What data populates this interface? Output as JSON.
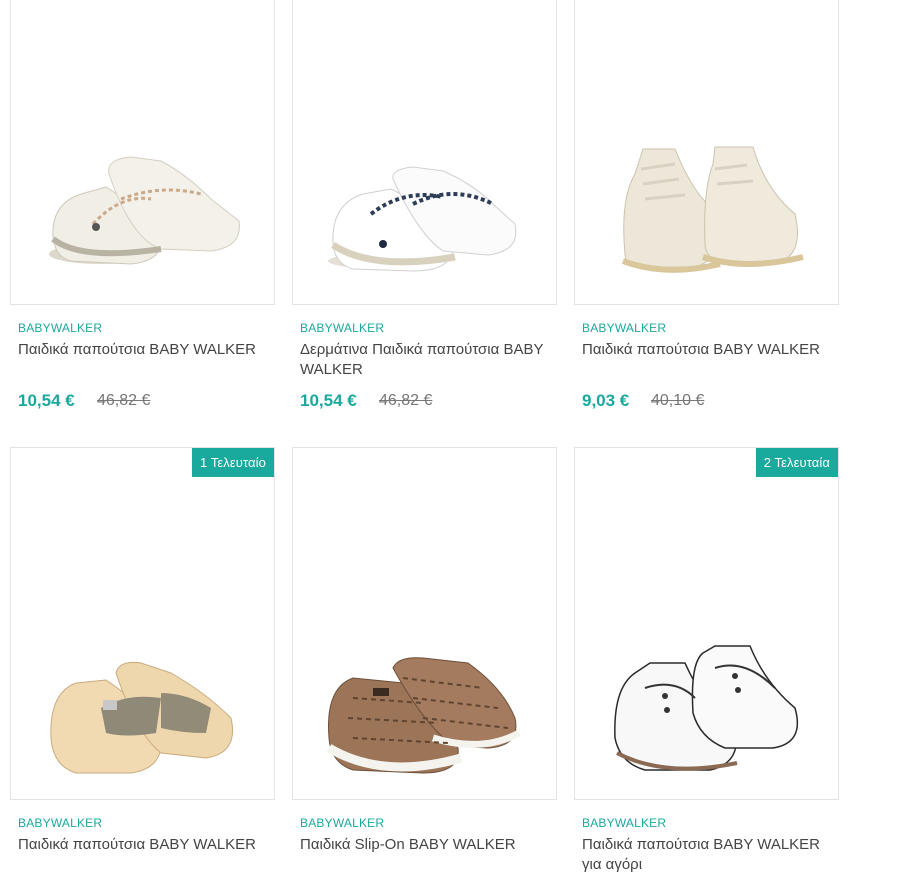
{
  "products": [
    {
      "brand": "BABYWALKER",
      "title": "Παιδικά παπούτσια BABY WALKER",
      "price": "10,54 €",
      "old_price": "46,82 €",
      "badge": "",
      "image": "white-loafer-beige-laces"
    },
    {
      "brand": "BABYWALKER",
      "title": "Δερμάτινα Παιδικά παπούτσια BABY WALKER",
      "price": "10,54 €",
      "old_price": "46,82 €",
      "badge": "",
      "image": "white-loafer-navy-laces"
    },
    {
      "brand": "BABYWALKER",
      "title": "Παιδικά παπούτσια BABY WALKER",
      "price": "9,03 €",
      "old_price": "40,10 €",
      "badge": "",
      "image": "cream-lace-up-boots"
    },
    {
      "brand": "BABYWALKER",
      "title": "Παιδικά παπούτσια BABY WALKER",
      "price": "",
      "old_price": "",
      "badge": "1 Τελευταίο",
      "image": "beige-velcro-shoes"
    },
    {
      "brand": "BABYWALKER",
      "title": "Παιδικά Slip-On BABY WALKER",
      "price": "",
      "old_price": "",
      "badge": "",
      "image": "tweed-slip-on"
    },
    {
      "brand": "BABYWALKER",
      "title": "Παιδικά παπούτσια BABY WALKER για αγόρι",
      "price": "",
      "old_price": "",
      "badge": "2 Τελευταία",
      "image": "white-lace-up-boots"
    }
  ],
  "colors": {
    "accent": "#1aa99d",
    "border": "#e3e3e3"
  }
}
